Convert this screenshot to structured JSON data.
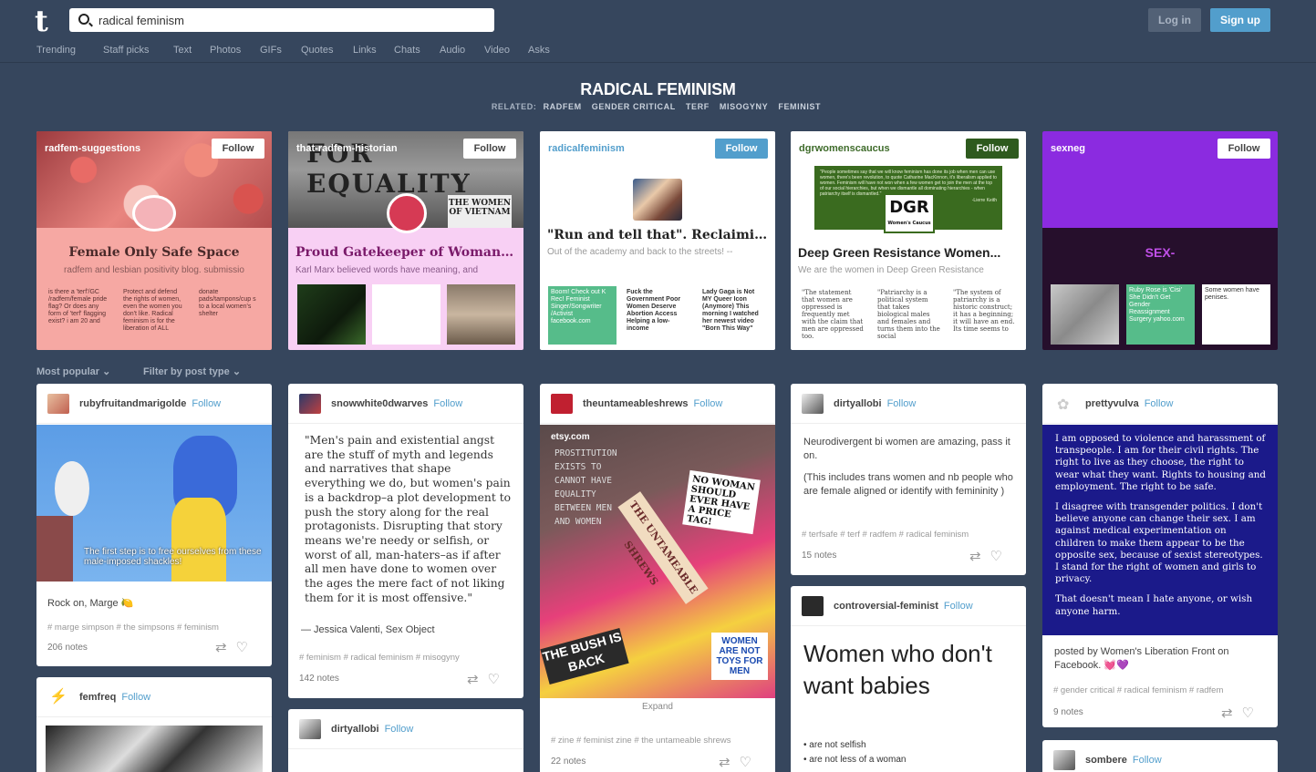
{
  "header": {
    "logo": "t",
    "search_value": "radical feminism",
    "login": "Log in",
    "signup": "Sign up"
  },
  "nav": [
    "Trending",
    "Staff picks",
    "Text",
    "Photos",
    "GIFs",
    "Quotes",
    "Links",
    "Chats",
    "Audio",
    "Video",
    "Asks"
  ],
  "page_title": "RADICAL FEMINISM",
  "related": {
    "label": "RELATED:",
    "items": [
      "RADFEM",
      "GENDER CRITICAL",
      "TERF",
      "MISOGYNY",
      "FEMINIST"
    ]
  },
  "blogs": [
    {
      "name": "radfem-suggestions",
      "follow": "Follow",
      "title": "Female Only Safe Space",
      "desc": "radfem and lesbian positivity blog. submissio",
      "minis": [
        "is there a 'terf'/GC /radfem/female pride flag? Or does any form of 'terf' flagging exist? i am 20 and",
        "Protect and defend the rights of women, even the women you don't like. Radical feminism is for the liberation of ALL",
        "donate pads/tampons/cup s to a local women's shelter"
      ]
    },
    {
      "name": "that-radfem-historian",
      "follow": "Follow",
      "title": "Proud Gatekeeper of Womanho...",
      "desc": "Karl Marx believed words have meaning, and",
      "banner": "FOR EQUALITY",
      "sign": "THE WOMEN OF VIETNAM"
    },
    {
      "name": "radicalfeminism",
      "follow": "Follow",
      "title": "\"Run and tell that\". Reclaiming ...",
      "desc": "Out of the academy and back to the streets! --",
      "minis": [
        "Boom! Check out K Rec! Feminist Singer/Songwriter /Activist facebook.com",
        "Fuck the Government Poor Women Deserve Abortion Access Helping a low-income",
        "Lady Gaga is Not MY Queer Icon (Anymore) This morning I watched her newest video \"Born This Way\""
      ]
    },
    {
      "name": "dgrwomenscaucus",
      "follow": "Follow",
      "title": "Deep Green Resistance Women...",
      "desc": "We are the women in Deep Green Resistance",
      "quote": "\"People sometimes say that we will know feminism has done its job when men can use women, there's been revolution, to quote Catharine MacKinnon, it's liberalism applied to women. Feminism will have not won when a few women get to join the men at the top of our social hierarchies, but when we dismantle all dominating hierarchies - when patriarchy itself is dismantled.\"",
      "quote_author": "-Lierre Keith",
      "logo": "DGR",
      "logo_sub": "Women's Caucus",
      "minis": [
        "\"The statement that women are oppressed is frequently met with the claim that men are oppressed too.",
        "\"Patriarchy is a political system that takes biological males and females and turns them into the social",
        "\"The system of patriarchy is a historic construct; it has a beginning; it will have an end. Its time seems to"
      ]
    },
    {
      "name": "sexneg",
      "follow": "Follow",
      "title": "SEX-",
      "minis": [
        "Ruby Rose is 'Cisi' She Didn't Get Gender Reassignment Surgery yahoo.com",
        "Some women have penises."
      ]
    }
  ],
  "filters": {
    "popular": "Most popular",
    "type": "Filter by post type"
  },
  "posts": {
    "p1": {
      "user": "rubyfruitandmarigolde",
      "follow": "Follow",
      "caption": "The first step is to free ourselves from these male-imposed shackles!",
      "text": "Rock on, Marge 🍋",
      "tags": "# marge simpson   # the simpsons   # feminism",
      "notes": "206 notes"
    },
    "p2": {
      "user": "femfreq",
      "follow": "Follow"
    },
    "p3": {
      "user": "snowwhite0dwarves",
      "follow": "Follow",
      "quote": "\"Men's pain and existential angst are the stuff of myth and legends and narratives that shape everything we do, but women's pain is a backdrop–a plot development to push the story along for the real protagonists. Disrupting that story means we're needy or selfish, or worst of all, man-haters–as if after all men have done to women over the ages the mere fact of not liking them for it is most offensive.\"",
      "source": "— Jessica Valenti, Sex Object",
      "tags": "# feminism   # radical feminism   # misogyny",
      "notes": "142 notes"
    },
    "p4": {
      "user": "dirtyallobi",
      "follow": "Follow"
    },
    "p5": {
      "user": "theuntameableshrews",
      "follow": "Follow",
      "etsy": "etsy.com",
      "zine_lines": [
        "PROSTITUTION",
        "EXISTS TO",
        "CANNOT HAVE",
        "EQUALITY",
        "BETWEEN MEN",
        "AND WOMEN"
      ],
      "sign1": "NO WOMAN SHOULD EVER HAVE A PRICE TAG!",
      "sign2": "WOMEN ARE NOT TOYS FOR MEN",
      "sign3": "THE BUSH IS BACK",
      "banner": "THE UNTAMEABLE SHREWS",
      "expand": "Expand",
      "tags": "# zine   # feminist zine   # the untameable shrews",
      "notes": "22 notes"
    },
    "p6": {
      "user": "dirtyallobi",
      "follow": "Follow",
      "text1": "Neurodivergent bi women are amazing, pass it on.",
      "text2": "(This includes trans women and nb people who are female aligned or identify with femininity )",
      "tags": "# terfsafe   # terf   # radfem   # radical feminism",
      "notes": "15 notes"
    },
    "p7": {
      "user": "controversial-feminist",
      "follow": "Follow",
      "heading": "Women who don't want babies",
      "b1": "• are not selfish",
      "b2": "• are not less of a woman"
    },
    "p8": {
      "user": "prettyvulva",
      "follow": "Follow",
      "body1": "I am opposed to violence and harassment of transpeople. I am for their civil rights. The right to live as they choose, the right to wear what they want. Rights to housing and employment. The right to be safe.",
      "body2": "I disagree with transgender politics. I don't believe anyone can change their sex. I am against medical experimentation on children to make them appear to be the opposite sex, because of sexist stereotypes. I stand for the right of women and girls to privacy.",
      "body3": "That doesn't mean I hate anyone, or wish anyone harm.",
      "posted": "posted by Women's Liberation Front on Facebook. 💓💜",
      "tags": "# gender critical   # radical feminism   # radfem",
      "notes": "9 notes"
    },
    "p9": {
      "user": "sombere",
      "follow": "Follow"
    }
  },
  "colors": {
    "bg": "#36465d",
    "accent": "#529ecc"
  }
}
